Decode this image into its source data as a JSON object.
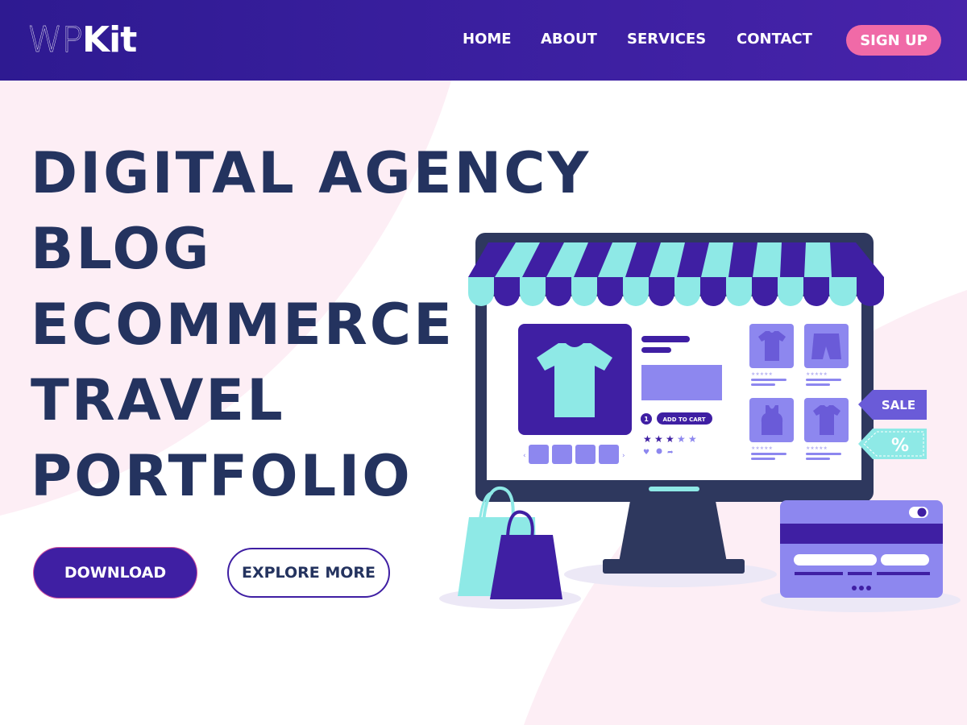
{
  "brand": {
    "logo_light": "WP",
    "logo_bold": "Kit"
  },
  "nav": {
    "items": [
      {
        "label": "HOME"
      },
      {
        "label": "ABOUT"
      },
      {
        "label": "SERVICES"
      },
      {
        "label": "CONTACT"
      }
    ],
    "signup_label": "SIGN UP"
  },
  "hero": {
    "lines": [
      "DIGITAL AGENCY",
      "BLOG",
      "ECOMMERCE",
      "TRAVEL",
      "PORTFOLIO"
    ],
    "download_label": "DOWNLOAD",
    "explore_label": "EXPLORE MORE"
  },
  "illustration": {
    "add_to_cart_label": "ADD TO CART",
    "quantity": "1",
    "sale_tag": "SALE",
    "percent_tag": "%",
    "product_rating": 3,
    "rating_max": 5
  },
  "colors": {
    "header": "#3a1f9f",
    "accent_pink": "#f06aa7",
    "heading_navy": "#24335f",
    "primary_purple": "#3f1fa3",
    "aqua": "#8ee9e6",
    "lavender": "#8d87ef"
  }
}
